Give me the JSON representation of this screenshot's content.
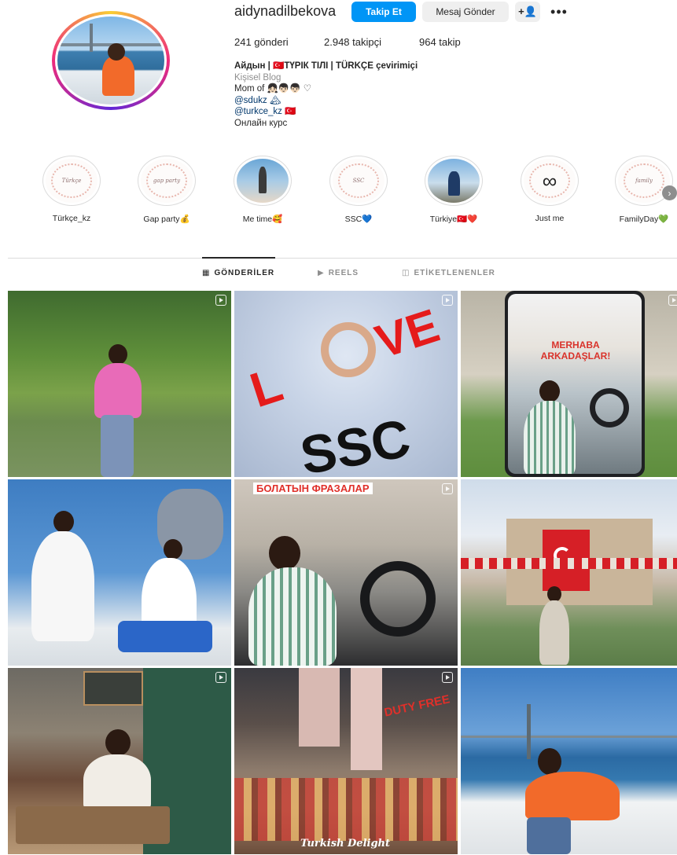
{
  "profile": {
    "username": "aidynadilbekova",
    "follow_label": "Takip Et",
    "message_label": "Mesaj Gönder",
    "suggest_icon": "+👤",
    "more_icon": "•••",
    "stats": {
      "posts": "241 gönderi",
      "followers": "2.948 takipçi",
      "following": "964 takip"
    },
    "bio": {
      "name": "Айдын | 🇹🇷ТҮРІК ТІЛІ | TÜRKÇE çevirimiçi",
      "category": "Kişisel Blog",
      "line1": "Mom of 👧🏻👦🏻👦🏻 ♡",
      "line2": "@sdukz 🏔",
      "line3": "@turkce_kz 🇹🇷",
      "line4": "Онлайн курс"
    }
  },
  "highlights": [
    {
      "label": "Türkçe_kz",
      "inner": "Türkçe"
    },
    {
      "label": "Gap party💰",
      "inner": "gap party"
    },
    {
      "label": "Me time🥰",
      "inner": ""
    },
    {
      "label": "SSC💙",
      "inner": "SSC"
    },
    {
      "label": "Türkiye🇹🇷❤️",
      "inner": ""
    },
    {
      "label": "Just me",
      "inner": "∞"
    },
    {
      "label": "FamilyDay💚",
      "inner": "family"
    }
  ],
  "highlights_next_icon": "›",
  "tabs": {
    "posts": "GÖNDERİLER",
    "reels": "REELS",
    "tagged": "ETİKETLENENLER",
    "posts_icon": "▦",
    "reels_icon": "▶",
    "tagged_icon": "◫"
  },
  "posts": {
    "p2_text1": "L",
    "p2_text2": "VE",
    "p2_text3": "SSC",
    "p3_title": "MERHABA ARKADAŞLAR!",
    "p5_title": "БОЛАТЫН ФРАЗАЛАР",
    "p8_sign": "DUTY FREE",
    "p8_sign2": "Turkish Delight"
  }
}
